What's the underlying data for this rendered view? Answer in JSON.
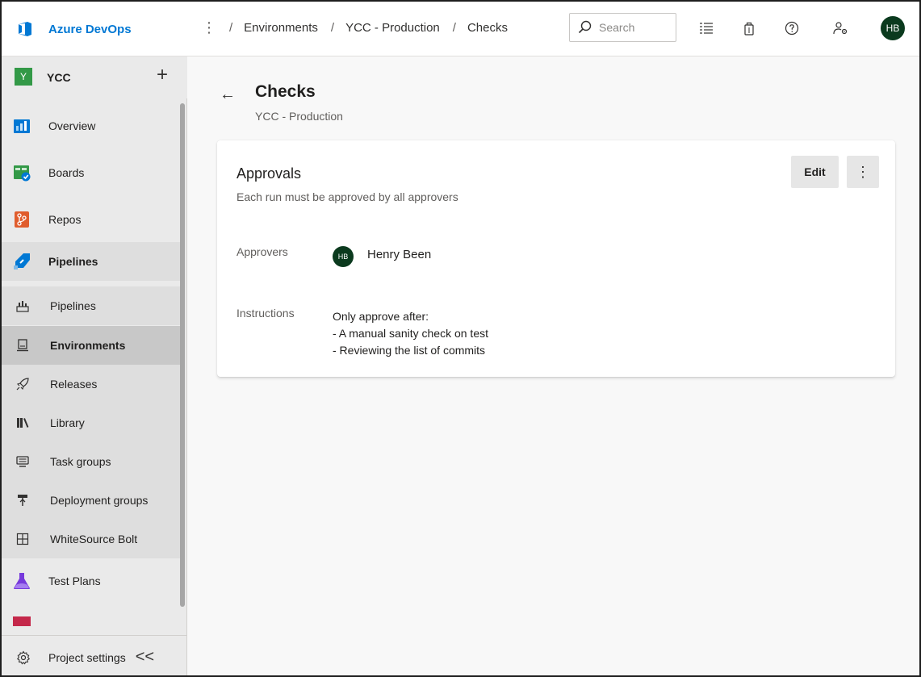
{
  "app": {
    "name": "Azure DevOps",
    "accent_color": "#0078d4"
  },
  "header": {
    "breadcrumbs": [
      "Environments",
      "YCC - Production",
      "Checks"
    ],
    "search_placeholder": "Search",
    "user_initials": "HB"
  },
  "sidebar": {
    "project_initial": "Y",
    "project_name": "YCC",
    "add_label": "+",
    "items": [
      {
        "label": "Overview",
        "icon": "overview-icon"
      },
      {
        "label": "Boards",
        "icon": "boards-icon"
      },
      {
        "label": "Repos",
        "icon": "repos-icon"
      },
      {
        "label": "Pipelines",
        "icon": "pipelines-icon"
      },
      {
        "label": "Pipelines",
        "icon": "pipelines-sub-icon"
      },
      {
        "label": "Environments",
        "icon": "environments-icon"
      },
      {
        "label": "Releases",
        "icon": "releases-icon"
      },
      {
        "label": "Library",
        "icon": "library-icon"
      },
      {
        "label": "Task groups",
        "icon": "task-groups-icon"
      },
      {
        "label": "Deployment groups",
        "icon": "deployment-groups-icon"
      },
      {
        "label": "WhiteSource Bolt",
        "icon": "whitesource-icon"
      },
      {
        "label": "Test Plans",
        "icon": "test-plans-icon"
      }
    ],
    "settings_label": "Project settings",
    "collapse_label": "<<"
  },
  "main": {
    "title": "Checks",
    "subtitle": "YCC - Production",
    "card": {
      "title": "Approvals",
      "description": "Each run must be approved by all approvers",
      "edit_label": "Edit",
      "more_label": "⋮",
      "approvers_label": "Approvers",
      "approver_initials": "HB",
      "approver_name": "Henry Been",
      "instructions_label": "Instructions",
      "instructions_lines": [
        "Only approve after:",
        "- A manual sanity check on test",
        "- Reviewing the list of commits"
      ]
    }
  }
}
